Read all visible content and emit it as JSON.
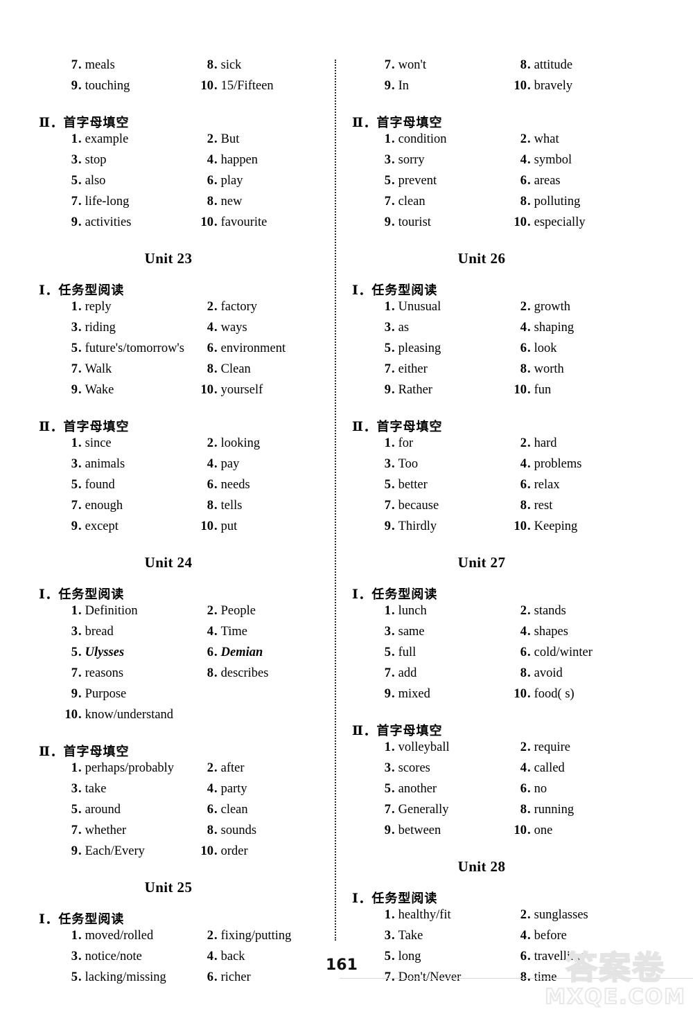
{
  "page": {
    "page_number": "161",
    "watermark_cn": "答案卷",
    "watermark_en": "MXQE.COM"
  },
  "labels": {
    "section_1": "Ⅰ．任务型阅读",
    "section_2": "Ⅱ．首字母填空",
    "section_1_roman": "Ⅰ",
    "section_2_roman": "Ⅱ",
    "unit_23": "Unit 23",
    "unit_24": "Unit 24",
    "unit_25": "Unit 25",
    "unit_26": "Unit 26",
    "unit_27": "Unit 27",
    "unit_28": "Unit 28"
  },
  "left_column": {
    "continued_reading": {
      "items": [
        {
          "n": "7",
          "v": "meals"
        },
        {
          "n": "8",
          "v": "sick"
        },
        {
          "n": "9",
          "v": "touching"
        },
        {
          "n": "10",
          "v": "15/Fifteen"
        }
      ]
    },
    "continued_cloze": {
      "items": [
        {
          "n": "1",
          "v": "example"
        },
        {
          "n": "2",
          "v": "But"
        },
        {
          "n": "3",
          "v": "stop"
        },
        {
          "n": "4",
          "v": "happen"
        },
        {
          "n": "5",
          "v": "also"
        },
        {
          "n": "6",
          "v": "play"
        },
        {
          "n": "7",
          "v": "life-long"
        },
        {
          "n": "8",
          "v": "new"
        },
        {
          "n": "9",
          "v": "activities"
        },
        {
          "n": "10",
          "v": "favourite"
        }
      ]
    },
    "unit23": {
      "reading": [
        {
          "n": "1",
          "v": "reply"
        },
        {
          "n": "2",
          "v": "factory"
        },
        {
          "n": "3",
          "v": "riding"
        },
        {
          "n": "4",
          "v": "ways"
        },
        {
          "n": "5",
          "v": "future's/tomorrow's"
        },
        {
          "n": "6",
          "v": "environment"
        },
        {
          "n": "7",
          "v": "Walk"
        },
        {
          "n": "8",
          "v": "Clean"
        },
        {
          "n": "9",
          "v": "Wake"
        },
        {
          "n": "10",
          "v": "yourself"
        }
      ],
      "cloze": [
        {
          "n": "1",
          "v": "since"
        },
        {
          "n": "2",
          "v": "looking"
        },
        {
          "n": "3",
          "v": "animals"
        },
        {
          "n": "4",
          "v": "pay"
        },
        {
          "n": "5",
          "v": "found"
        },
        {
          "n": "6",
          "v": "needs"
        },
        {
          "n": "7",
          "v": "enough"
        },
        {
          "n": "8",
          "v": "tells"
        },
        {
          "n": "9",
          "v": "except"
        },
        {
          "n": "10",
          "v": "put"
        }
      ]
    },
    "unit24": {
      "reading": [
        {
          "n": "1",
          "v": "Definition"
        },
        {
          "n": "2",
          "v": "People"
        },
        {
          "n": "3",
          "v": "bread"
        },
        {
          "n": "4",
          "v": "Time"
        },
        {
          "n": "5",
          "v": "Ulysses"
        },
        {
          "n": "6",
          "v": "Demian"
        },
        {
          "n": "7",
          "v": "reasons"
        },
        {
          "n": "8",
          "v": "describes"
        },
        {
          "n": "9",
          "v": "Purpose"
        },
        {
          "n": "10",
          "v": "know/understand"
        }
      ],
      "cloze": [
        {
          "n": "1",
          "v": "perhaps/probably"
        },
        {
          "n": "2",
          "v": "after"
        },
        {
          "n": "3",
          "v": "take"
        },
        {
          "n": "4",
          "v": "party"
        },
        {
          "n": "5",
          "v": "around"
        },
        {
          "n": "6",
          "v": "clean"
        },
        {
          "n": "7",
          "v": "whether"
        },
        {
          "n": "8",
          "v": "sounds"
        },
        {
          "n": "9",
          "v": "Each/Every"
        },
        {
          "n": "10",
          "v": "order"
        }
      ]
    },
    "unit25": {
      "reading": [
        {
          "n": "1",
          "v": "moved/rolled"
        },
        {
          "n": "2",
          "v": "fixing/putting"
        },
        {
          "n": "3",
          "v": "notice/note"
        },
        {
          "n": "4",
          "v": "back"
        },
        {
          "n": "5",
          "v": "lacking/missing"
        },
        {
          "n": "6",
          "v": "richer"
        }
      ]
    }
  },
  "right_column": {
    "continued_reading": {
      "items": [
        {
          "n": "7",
          "v": "won't"
        },
        {
          "n": "8",
          "v": "attitude"
        },
        {
          "n": "9",
          "v": "In"
        },
        {
          "n": "10",
          "v": "bravely"
        }
      ]
    },
    "continued_cloze": {
      "items": [
        {
          "n": "1",
          "v": "condition"
        },
        {
          "n": "2",
          "v": "what"
        },
        {
          "n": "3",
          "v": "sorry"
        },
        {
          "n": "4",
          "v": "symbol"
        },
        {
          "n": "5",
          "v": "prevent"
        },
        {
          "n": "6",
          "v": "areas"
        },
        {
          "n": "7",
          "v": "clean"
        },
        {
          "n": "8",
          "v": "polluting"
        },
        {
          "n": "9",
          "v": "tourist"
        },
        {
          "n": "10",
          "v": "especially"
        }
      ]
    },
    "unit26": {
      "reading": [
        {
          "n": "1",
          "v": "Unusual"
        },
        {
          "n": "2",
          "v": "growth"
        },
        {
          "n": "3",
          "v": "as"
        },
        {
          "n": "4",
          "v": "shaping"
        },
        {
          "n": "5",
          "v": "pleasing"
        },
        {
          "n": "6",
          "v": "look"
        },
        {
          "n": "7",
          "v": "either"
        },
        {
          "n": "8",
          "v": "worth"
        },
        {
          "n": "9",
          "v": "Rather"
        },
        {
          "n": "10",
          "v": "fun"
        }
      ],
      "cloze": [
        {
          "n": "1",
          "v": "for"
        },
        {
          "n": "2",
          "v": "hard"
        },
        {
          "n": "3",
          "v": "Too"
        },
        {
          "n": "4",
          "v": "problems"
        },
        {
          "n": "5",
          "v": "better"
        },
        {
          "n": "6",
          "v": "relax"
        },
        {
          "n": "7",
          "v": "because"
        },
        {
          "n": "8",
          "v": "rest"
        },
        {
          "n": "9",
          "v": "Thirdly"
        },
        {
          "n": "10",
          "v": "Keeping"
        }
      ]
    },
    "unit27": {
      "reading": [
        {
          "n": "1",
          "v": "lunch"
        },
        {
          "n": "2",
          "v": "stands"
        },
        {
          "n": "3",
          "v": "same"
        },
        {
          "n": "4",
          "v": "shapes"
        },
        {
          "n": "5",
          "v": "full"
        },
        {
          "n": "6",
          "v": "cold/winter"
        },
        {
          "n": "7",
          "v": "add"
        },
        {
          "n": "8",
          "v": "avoid"
        },
        {
          "n": "9",
          "v": "mixed"
        },
        {
          "n": "10",
          "v": "food( s)"
        }
      ],
      "cloze": [
        {
          "n": "1",
          "v": "volleyball"
        },
        {
          "n": "2",
          "v": "require"
        },
        {
          "n": "3",
          "v": "scores"
        },
        {
          "n": "4",
          "v": "called"
        },
        {
          "n": "5",
          "v": "another"
        },
        {
          "n": "6",
          "v": "no"
        },
        {
          "n": "7",
          "v": "Generally"
        },
        {
          "n": "8",
          "v": "running"
        },
        {
          "n": "9",
          "v": "between"
        },
        {
          "n": "10",
          "v": "one"
        }
      ]
    },
    "unit28": {
      "reading": [
        {
          "n": "1",
          "v": "healthy/fit"
        },
        {
          "n": "2",
          "v": "sunglasses"
        },
        {
          "n": "3",
          "v": "Take"
        },
        {
          "n": "4",
          "v": "before"
        },
        {
          "n": "5",
          "v": "long"
        },
        {
          "n": "6",
          "v": "travelling"
        },
        {
          "n": "7",
          "v": "Don't/Never"
        },
        {
          "n": "8",
          "v": "time"
        }
      ]
    }
  }
}
